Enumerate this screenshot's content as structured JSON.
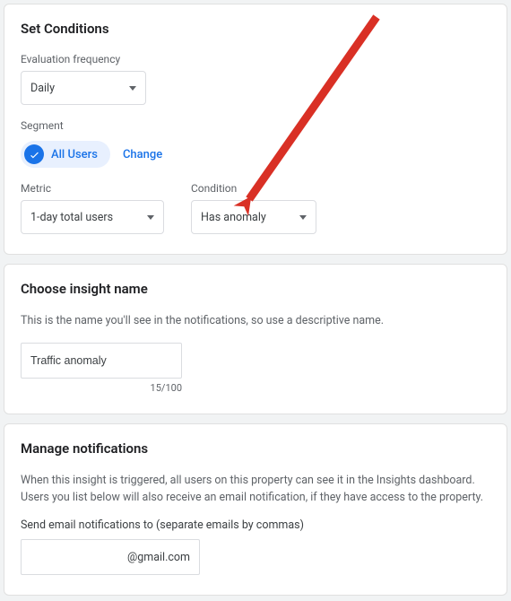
{
  "set_conditions": {
    "title": "Set Conditions",
    "eval_freq_label": "Evaluation frequency",
    "eval_freq_value": "Daily",
    "segment_label": "Segment",
    "segment_chip": "All Users",
    "change_label": "Change",
    "metric_label": "Metric",
    "metric_value": "1-day total users",
    "condition_label": "Condition",
    "condition_value": "Has anomaly"
  },
  "insight_name": {
    "title": "Choose insight name",
    "helper": "This is the name you'll see in the notifications, so use a descriptive name.",
    "value": "Traffic anomaly",
    "counter": "15/100"
  },
  "notifications": {
    "title": "Manage notifications",
    "helper": "When this insight is triggered, all users on this property can see it in the Insights dashboard. Users you list below will also receive an email notification, if they have access to the property.",
    "send_label": "Send email notifications to (separate emails by commas)",
    "email_value": "@gmail.com"
  }
}
